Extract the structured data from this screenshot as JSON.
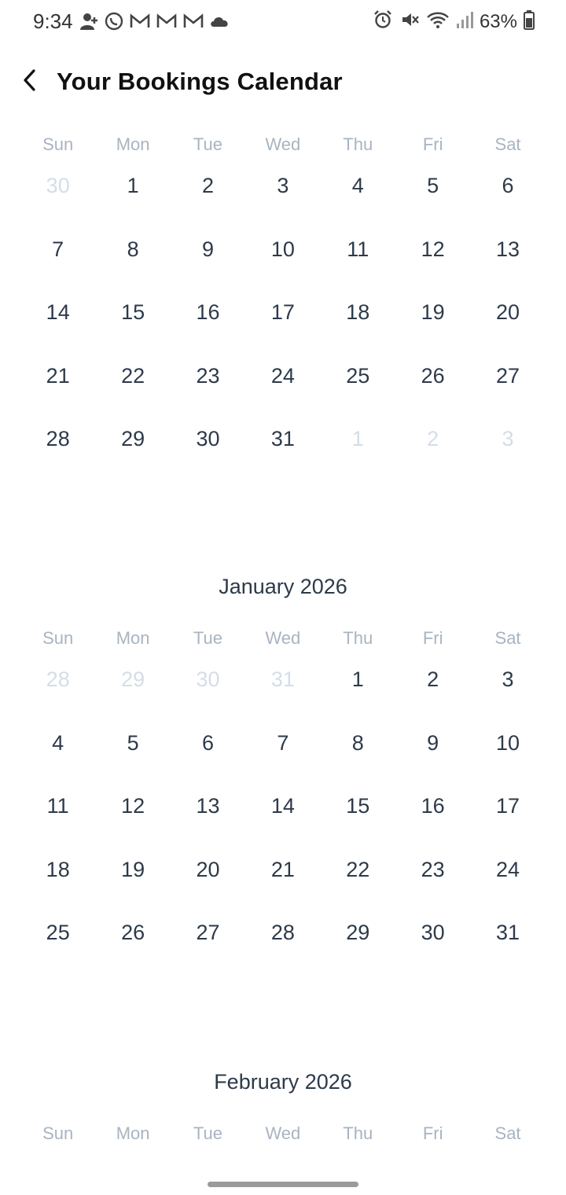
{
  "status_bar": {
    "time": "9:34",
    "battery": "63%",
    "left_icons": [
      "contact-add-icon",
      "whatsapp-icon",
      "gmail-icon",
      "gmail-icon",
      "gmail-icon",
      "cloud-icon"
    ],
    "right_icons": [
      "alarm-icon",
      "mute-icon",
      "wifi-icon",
      "signal-icon",
      "battery-icon"
    ]
  },
  "header": {
    "title": "Your Bookings Calendar",
    "back_icon": "chevron-left-icon"
  },
  "weekdays": [
    "Sun",
    "Mon",
    "Tue",
    "Wed",
    "Thu",
    "Fri",
    "Sat"
  ],
  "months": [
    {
      "title": "",
      "days": [
        {
          "n": "30",
          "muted": true
        },
        {
          "n": "1"
        },
        {
          "n": "2"
        },
        {
          "n": "3"
        },
        {
          "n": "4"
        },
        {
          "n": "5"
        },
        {
          "n": "6"
        },
        {
          "n": "7"
        },
        {
          "n": "8"
        },
        {
          "n": "9"
        },
        {
          "n": "10"
        },
        {
          "n": "11"
        },
        {
          "n": "12"
        },
        {
          "n": "13"
        },
        {
          "n": "14"
        },
        {
          "n": "15"
        },
        {
          "n": "16"
        },
        {
          "n": "17"
        },
        {
          "n": "18"
        },
        {
          "n": "19"
        },
        {
          "n": "20"
        },
        {
          "n": "21"
        },
        {
          "n": "22"
        },
        {
          "n": "23"
        },
        {
          "n": "24"
        },
        {
          "n": "25"
        },
        {
          "n": "26"
        },
        {
          "n": "27"
        },
        {
          "n": "28"
        },
        {
          "n": "29"
        },
        {
          "n": "30"
        },
        {
          "n": "31"
        },
        {
          "n": "1",
          "muted": true
        },
        {
          "n": "2",
          "muted": true
        },
        {
          "n": "3",
          "muted": true
        }
      ]
    },
    {
      "title": "January 2026",
      "days": [
        {
          "n": "28",
          "muted": true
        },
        {
          "n": "29",
          "muted": true
        },
        {
          "n": "30",
          "muted": true
        },
        {
          "n": "31",
          "muted": true
        },
        {
          "n": "1"
        },
        {
          "n": "2"
        },
        {
          "n": "3"
        },
        {
          "n": "4"
        },
        {
          "n": "5"
        },
        {
          "n": "6"
        },
        {
          "n": "7"
        },
        {
          "n": "8"
        },
        {
          "n": "9"
        },
        {
          "n": "10"
        },
        {
          "n": "11"
        },
        {
          "n": "12"
        },
        {
          "n": "13"
        },
        {
          "n": "14"
        },
        {
          "n": "15"
        },
        {
          "n": "16"
        },
        {
          "n": "17"
        },
        {
          "n": "18"
        },
        {
          "n": "19"
        },
        {
          "n": "20"
        },
        {
          "n": "21"
        },
        {
          "n": "22"
        },
        {
          "n": "23"
        },
        {
          "n": "24"
        },
        {
          "n": "25"
        },
        {
          "n": "26"
        },
        {
          "n": "27"
        },
        {
          "n": "28"
        },
        {
          "n": "29"
        },
        {
          "n": "30"
        },
        {
          "n": "31"
        }
      ]
    },
    {
      "title": "February 2026",
      "days": []
    }
  ],
  "colors": {
    "text": "#2d3a4a",
    "muted_day": "#d5dde6",
    "weekday": "#a8b4c2"
  }
}
